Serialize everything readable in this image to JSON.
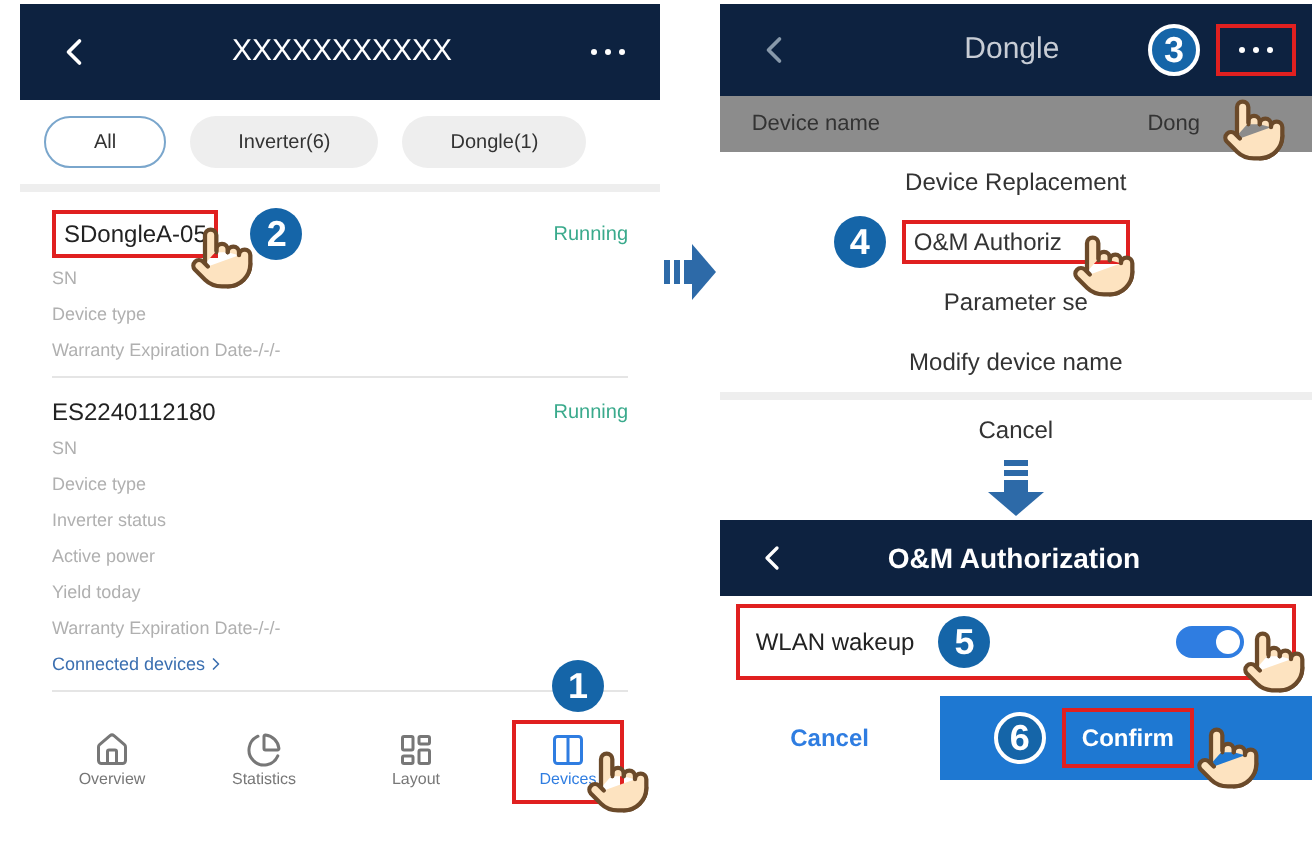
{
  "device_list_screen": {
    "header": {
      "title": "XXXXXXXXXXX"
    },
    "filters": [
      {
        "label": "All",
        "selected": true
      },
      {
        "label": "Inverter(6)",
        "selected": false
      },
      {
        "label": "Dongle(1)",
        "selected": false
      }
    ],
    "devices": [
      {
        "name": "SDongleA-05",
        "status": "Running",
        "highlighted": true,
        "step": "2",
        "fields": [
          "SN",
          "Device type",
          "Warranty Expiration Date-/-/-"
        ]
      },
      {
        "name": "ES2240112180",
        "status": "Running",
        "highlighted": false,
        "fields": [
          "SN",
          "Device type",
          "Inverter status",
          "Active power",
          "Yield today",
          "Warranty Expiration Date-/-/-"
        ],
        "link": "Connected devices"
      }
    ],
    "nav": [
      {
        "label": "Overview",
        "kind": "home",
        "selected": false,
        "highlighted": false
      },
      {
        "label": "Statistics",
        "kind": "pie",
        "selected": false,
        "highlighted": false
      },
      {
        "label": "Layout",
        "kind": "layout",
        "selected": false,
        "highlighted": false
      },
      {
        "label": "Devices",
        "kind": "devices",
        "selected": true,
        "highlighted": true,
        "step": "1"
      }
    ]
  },
  "dongle_screen": {
    "header": {
      "title": "Dongle",
      "step": "3"
    },
    "row": {
      "label": "Device name",
      "value": "Dong"
    },
    "menu": [
      {
        "label": "Device Replacement",
        "highlighted": false
      },
      {
        "label": "O&M Authoriz",
        "highlighted": true,
        "step": "4"
      },
      {
        "label": "Parameter se",
        "highlighted": false
      },
      {
        "label": "Modify device name",
        "highlighted": false
      }
    ],
    "cancel": "Cancel"
  },
  "authorization_screen": {
    "header": {
      "title": "O&M Authorization"
    },
    "setting": {
      "label": "WLAN wakeup",
      "on": true,
      "step": "5"
    },
    "buttons": [
      {
        "label": "Cancel",
        "kind": "text"
      },
      {
        "label": "Confirm",
        "kind": "primary",
        "step": "6"
      }
    ]
  }
}
